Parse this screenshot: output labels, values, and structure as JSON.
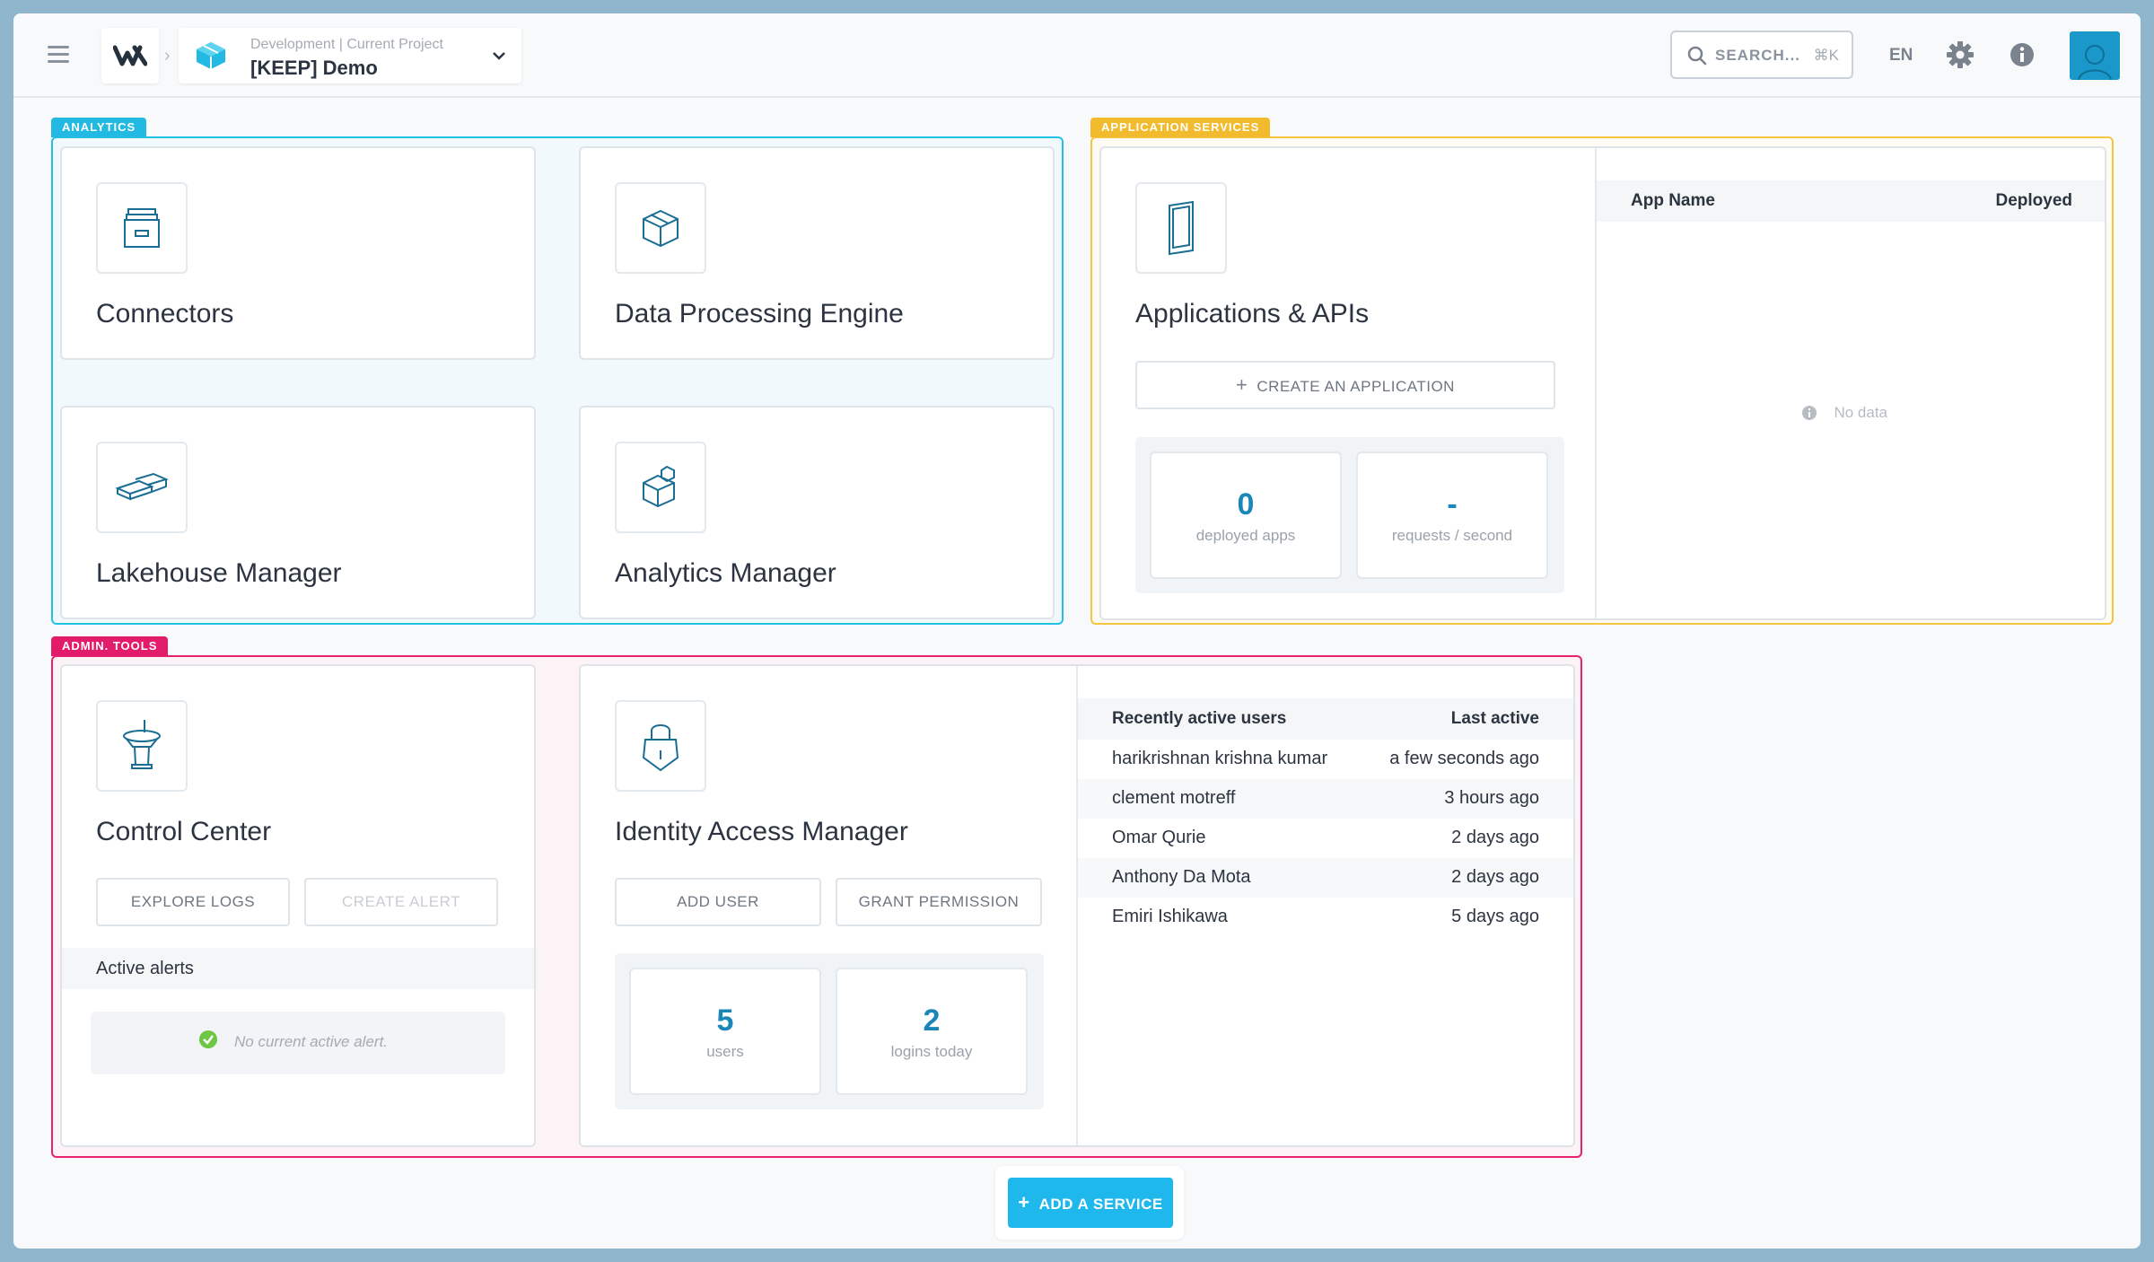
{
  "header": {
    "project_env": "Development | Current Project",
    "project_name": "[KEEP] Demo",
    "search_label": "SEARCH...",
    "search_shortcut": "⌘K",
    "language": "EN"
  },
  "groups": {
    "analytics": "ANALYTICS",
    "app_services": "APPLICATION SERVICES",
    "admin_tools": "ADMIN. TOOLS"
  },
  "analytics": {
    "connectors": "Connectors",
    "dpe": "Data Processing Engine",
    "lakehouse": "Lakehouse Manager",
    "analytics_manager": "Analytics Manager"
  },
  "app_services": {
    "title": "Applications & APIs",
    "create_app": "CREATE AN APPLICATION",
    "stats": [
      {
        "value": "0",
        "label": "deployed apps"
      },
      {
        "value": "-",
        "label": "requests / second"
      }
    ],
    "table": {
      "col_name": "App Name",
      "col_deployed": "Deployed",
      "empty": "No data"
    }
  },
  "control_center": {
    "title": "Control Center",
    "explore_logs": "EXPLORE LOGS",
    "create_alert": "CREATE ALERT",
    "active_alerts": "Active alerts",
    "no_alert": "No current active alert."
  },
  "iam": {
    "title": "Identity Access Manager",
    "add_user": "ADD USER",
    "grant_permission": "GRANT PERMISSION",
    "stats": [
      {
        "value": "5",
        "label": "users"
      },
      {
        "value": "2",
        "label": "logins today"
      }
    ],
    "table": {
      "col_user": "Recently active users",
      "col_last": "Last active",
      "rows": [
        {
          "name": "harikrishnan krishna kumar",
          "time": "a few seconds ago"
        },
        {
          "name": "clement motreff",
          "time": "3 hours ago"
        },
        {
          "name": "Omar Qurie",
          "time": "2 days ago"
        },
        {
          "name": "Anthony Da Mota",
          "time": "2 days ago"
        },
        {
          "name": "Emiri Ishikawa",
          "time": "5 days ago"
        }
      ]
    }
  },
  "footer": {
    "add_service": "ADD A SERVICE"
  },
  "colors": {
    "analytics": "#22c2e6",
    "app_services": "#f5c542",
    "admin_tools": "#e8226e",
    "accent": "#1fb8ec",
    "stat_value": "#1a87b8"
  }
}
